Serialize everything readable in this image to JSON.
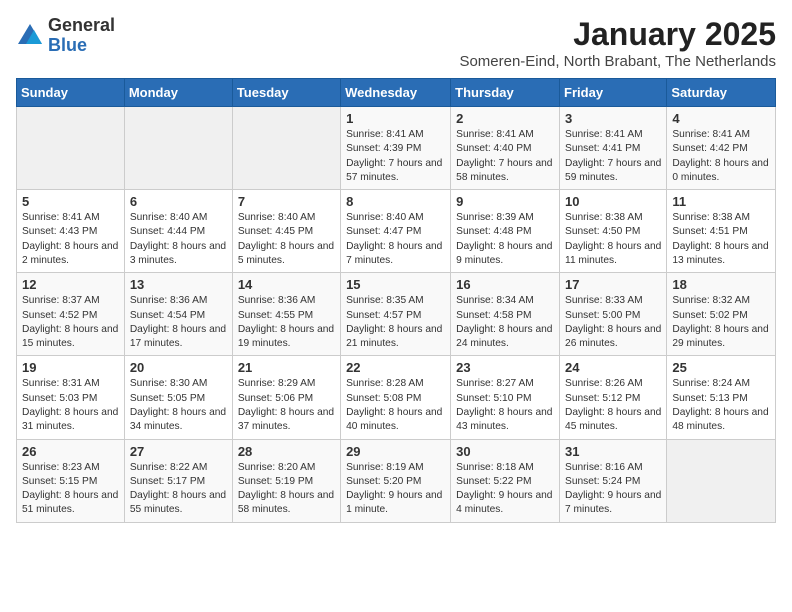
{
  "header": {
    "logo_general": "General",
    "logo_blue": "Blue",
    "title": "January 2025",
    "subtitle": "Someren-Eind, North Brabant, The Netherlands"
  },
  "weekdays": [
    "Sunday",
    "Monday",
    "Tuesday",
    "Wednesday",
    "Thursday",
    "Friday",
    "Saturday"
  ],
  "weeks": [
    [
      {
        "day": "",
        "info": ""
      },
      {
        "day": "",
        "info": ""
      },
      {
        "day": "",
        "info": ""
      },
      {
        "day": "1",
        "info": "Sunrise: 8:41 AM\nSunset: 4:39 PM\nDaylight: 7 hours and 57 minutes."
      },
      {
        "day": "2",
        "info": "Sunrise: 8:41 AM\nSunset: 4:40 PM\nDaylight: 7 hours and 58 minutes."
      },
      {
        "day": "3",
        "info": "Sunrise: 8:41 AM\nSunset: 4:41 PM\nDaylight: 7 hours and 59 minutes."
      },
      {
        "day": "4",
        "info": "Sunrise: 8:41 AM\nSunset: 4:42 PM\nDaylight: 8 hours and 0 minutes."
      }
    ],
    [
      {
        "day": "5",
        "info": "Sunrise: 8:41 AM\nSunset: 4:43 PM\nDaylight: 8 hours and 2 minutes."
      },
      {
        "day": "6",
        "info": "Sunrise: 8:40 AM\nSunset: 4:44 PM\nDaylight: 8 hours and 3 minutes."
      },
      {
        "day": "7",
        "info": "Sunrise: 8:40 AM\nSunset: 4:45 PM\nDaylight: 8 hours and 5 minutes."
      },
      {
        "day": "8",
        "info": "Sunrise: 8:40 AM\nSunset: 4:47 PM\nDaylight: 8 hours and 7 minutes."
      },
      {
        "day": "9",
        "info": "Sunrise: 8:39 AM\nSunset: 4:48 PM\nDaylight: 8 hours and 9 minutes."
      },
      {
        "day": "10",
        "info": "Sunrise: 8:38 AM\nSunset: 4:50 PM\nDaylight: 8 hours and 11 minutes."
      },
      {
        "day": "11",
        "info": "Sunrise: 8:38 AM\nSunset: 4:51 PM\nDaylight: 8 hours and 13 minutes."
      }
    ],
    [
      {
        "day": "12",
        "info": "Sunrise: 8:37 AM\nSunset: 4:52 PM\nDaylight: 8 hours and 15 minutes."
      },
      {
        "day": "13",
        "info": "Sunrise: 8:36 AM\nSunset: 4:54 PM\nDaylight: 8 hours and 17 minutes."
      },
      {
        "day": "14",
        "info": "Sunrise: 8:36 AM\nSunset: 4:55 PM\nDaylight: 8 hours and 19 minutes."
      },
      {
        "day": "15",
        "info": "Sunrise: 8:35 AM\nSunset: 4:57 PM\nDaylight: 8 hours and 21 minutes."
      },
      {
        "day": "16",
        "info": "Sunrise: 8:34 AM\nSunset: 4:58 PM\nDaylight: 8 hours and 24 minutes."
      },
      {
        "day": "17",
        "info": "Sunrise: 8:33 AM\nSunset: 5:00 PM\nDaylight: 8 hours and 26 minutes."
      },
      {
        "day": "18",
        "info": "Sunrise: 8:32 AM\nSunset: 5:02 PM\nDaylight: 8 hours and 29 minutes."
      }
    ],
    [
      {
        "day": "19",
        "info": "Sunrise: 8:31 AM\nSunset: 5:03 PM\nDaylight: 8 hours and 31 minutes."
      },
      {
        "day": "20",
        "info": "Sunrise: 8:30 AM\nSunset: 5:05 PM\nDaylight: 8 hours and 34 minutes."
      },
      {
        "day": "21",
        "info": "Sunrise: 8:29 AM\nSunset: 5:06 PM\nDaylight: 8 hours and 37 minutes."
      },
      {
        "day": "22",
        "info": "Sunrise: 8:28 AM\nSunset: 5:08 PM\nDaylight: 8 hours and 40 minutes."
      },
      {
        "day": "23",
        "info": "Sunrise: 8:27 AM\nSunset: 5:10 PM\nDaylight: 8 hours and 43 minutes."
      },
      {
        "day": "24",
        "info": "Sunrise: 8:26 AM\nSunset: 5:12 PM\nDaylight: 8 hours and 45 minutes."
      },
      {
        "day": "25",
        "info": "Sunrise: 8:24 AM\nSunset: 5:13 PM\nDaylight: 8 hours and 48 minutes."
      }
    ],
    [
      {
        "day": "26",
        "info": "Sunrise: 8:23 AM\nSunset: 5:15 PM\nDaylight: 8 hours and 51 minutes."
      },
      {
        "day": "27",
        "info": "Sunrise: 8:22 AM\nSunset: 5:17 PM\nDaylight: 8 hours and 55 minutes."
      },
      {
        "day": "28",
        "info": "Sunrise: 8:20 AM\nSunset: 5:19 PM\nDaylight: 8 hours and 58 minutes."
      },
      {
        "day": "29",
        "info": "Sunrise: 8:19 AM\nSunset: 5:20 PM\nDaylight: 9 hours and 1 minute."
      },
      {
        "day": "30",
        "info": "Sunrise: 8:18 AM\nSunset: 5:22 PM\nDaylight: 9 hours and 4 minutes."
      },
      {
        "day": "31",
        "info": "Sunrise: 8:16 AM\nSunset: 5:24 PM\nDaylight: 9 hours and 7 minutes."
      },
      {
        "day": "",
        "info": ""
      }
    ]
  ]
}
